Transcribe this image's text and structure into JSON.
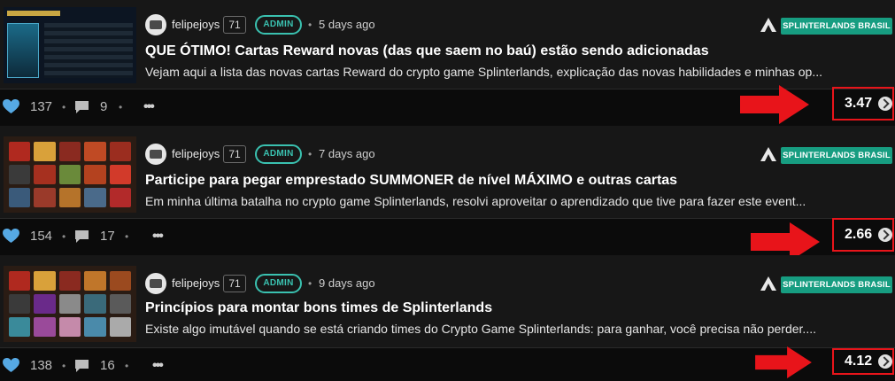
{
  "posts": [
    {
      "author": "felipejoys",
      "reputation": "71",
      "role": "ADMIN",
      "time": "5 days ago",
      "community": "SPLINTERLANDS BRASIL",
      "title": "QUE ÓTIMO! Cartas Reward novas (das que saem no baú) estão sendo adicionadas",
      "excerpt": "Vejam aqui a lista das novas cartas Reward do crypto game Splinterlands, explicação das novas habilidades e minhas op...",
      "votes": "137",
      "comments": "9",
      "payout": "3.47"
    },
    {
      "author": "felipejoys",
      "reputation": "71",
      "role": "ADMIN",
      "time": "7 days ago",
      "community": "SPLINTERLANDS BRASIL",
      "title": "Participe para pegar emprestado SUMMONER de nível MÁXIMO e outras cartas",
      "excerpt": "Em minha última batalha no crypto game Splinterlands, resolvi aproveitar o aprendizado que tive para fazer este event...",
      "votes": "154",
      "comments": "17",
      "payout": "2.66"
    },
    {
      "author": "felipejoys",
      "reputation": "71",
      "role": "ADMIN",
      "time": "9 days ago",
      "community": "SPLINTERLANDS BRASIL",
      "title": "Princípios para montar bons times de Splinterlands",
      "excerpt": "Existe algo imutável quando se está criando times do Crypto Game Splinterlands: para ganhar, você precisa não perder....",
      "votes": "138",
      "comments": "16",
      "payout": "4.12"
    }
  ],
  "icons": {
    "vote": "heart-icon",
    "comment": "comment-icon",
    "more": "more-icon",
    "community": "peak-logo-icon",
    "currency": "hive-icon",
    "annotation": "red-arrow-icon"
  },
  "colors": {
    "background": "#0b0b0b",
    "card": "#171717",
    "accent_teal": "#3ac1b0",
    "community_badge": "#179d81",
    "heart_blue": "#56a9e4",
    "annotation_red": "#e8141a"
  }
}
